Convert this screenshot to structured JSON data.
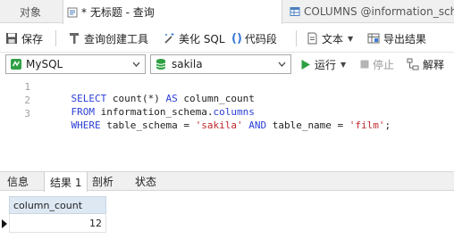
{
  "tabs": [
    {
      "label": "对象",
      "active": false,
      "icon": "none"
    },
    {
      "label": "* 无标题 - 查询",
      "active": true,
      "icon": "query-icon"
    },
    {
      "label": "COLUMNS @information_sche",
      "active": false,
      "icon": "table-icon"
    }
  ],
  "toolbar": {
    "save": "保存",
    "query_builder": "查询创建工具",
    "beautify_sql": "美化 SQL",
    "code_snippet": "代码段",
    "text": "文本",
    "export_results": "导出结果"
  },
  "connection": {
    "engine": "MySQL",
    "database": "sakila",
    "run": "运行",
    "stop": "停止",
    "explain": "解释"
  },
  "editor": {
    "line_numbers": [
      "1",
      "2",
      "3"
    ],
    "lines": [
      [
        {
          "t": "SELECT ",
          "c": "kw"
        },
        {
          "t": "count(*) ",
          "c": "id"
        },
        {
          "t": "AS ",
          "c": "kw"
        },
        {
          "t": "column_count",
          "c": "id"
        }
      ],
      [
        {
          "t": "FROM ",
          "c": "kw"
        },
        {
          "t": "information_schema",
          "c": "id"
        },
        {
          "t": ".",
          "c": "id"
        },
        {
          "t": "columns",
          "c": "kw"
        }
      ],
      [
        {
          "t": "WHERE ",
          "c": "kw"
        },
        {
          "t": "table_schema = ",
          "c": "id"
        },
        {
          "t": "'sakila'",
          "c": "str"
        },
        {
          "t": " AND ",
          "c": "kw"
        },
        {
          "t": "table_name = ",
          "c": "id"
        },
        {
          "t": "'film'",
          "c": "str"
        },
        {
          "t": ";",
          "c": "id"
        }
      ]
    ]
  },
  "result_tabs": [
    {
      "label": "信息",
      "active": false
    },
    {
      "label": "结果 1",
      "active": true
    },
    {
      "label": "剖析",
      "active": false
    },
    {
      "label": "状态",
      "active": false
    }
  ],
  "grid": {
    "columns": [
      "column_count"
    ],
    "rows": [
      [
        "12"
      ]
    ]
  },
  "colors": {
    "keyword": "#2b3fd6",
    "string": "#c0282d",
    "run_green": "#2ea043",
    "header_bg": "#dde8f3"
  }
}
